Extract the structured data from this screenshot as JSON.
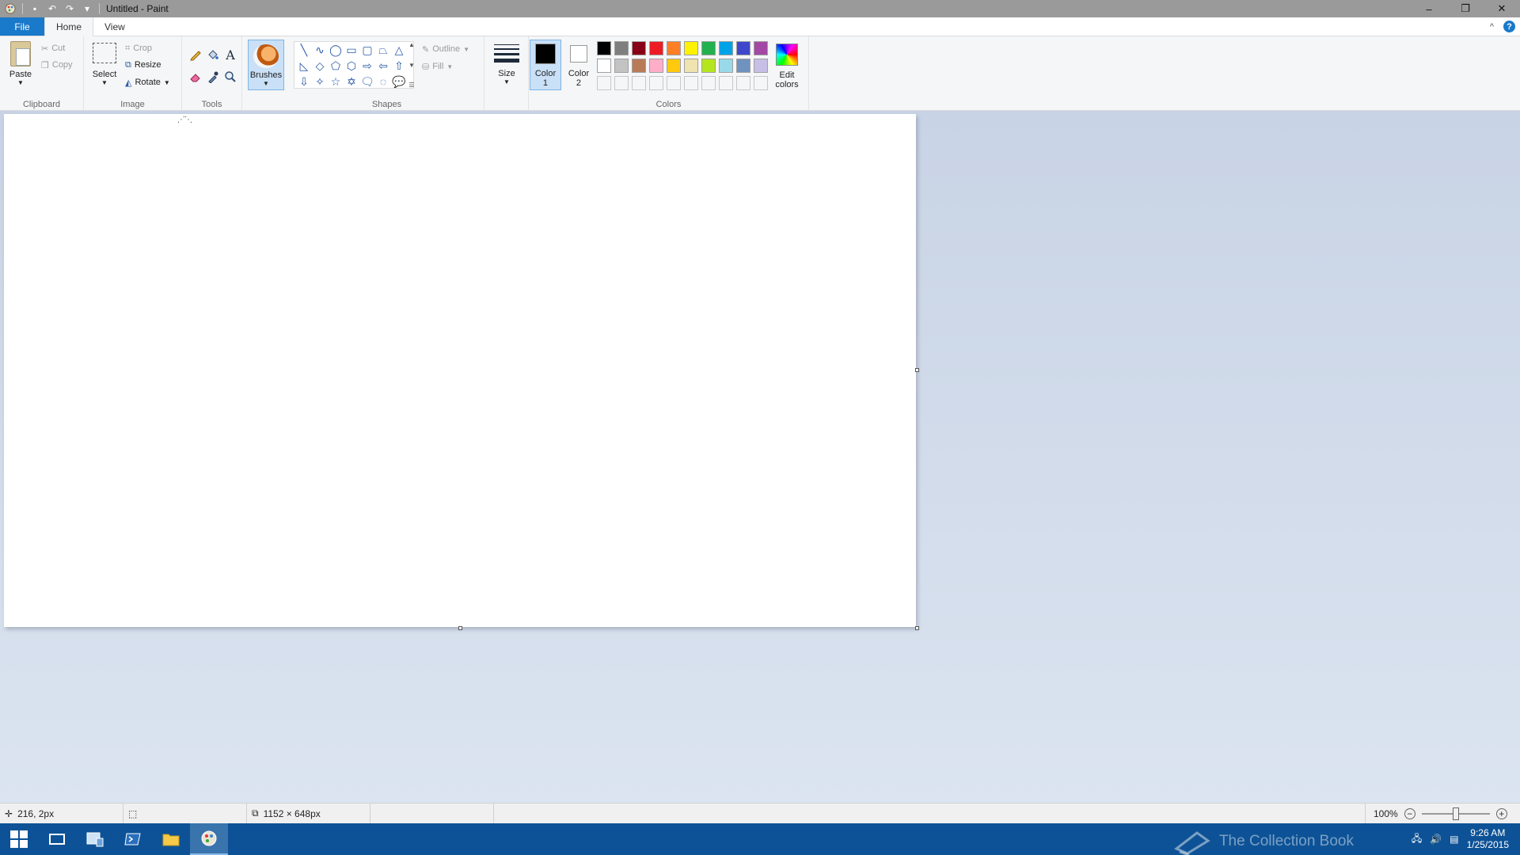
{
  "window": {
    "title": "Untitled - Paint",
    "minimize_glyph": "–",
    "restore_glyph": "❐",
    "close_glyph": "✕"
  },
  "quick_access": {
    "icons": [
      "paint-app-icon",
      "save-icon",
      "undo-icon",
      "redo-icon",
      "customize-qat-icon"
    ],
    "save_glyph": "▪",
    "undo_glyph": "↶",
    "redo_glyph": "↷",
    "customize_glyph": "▾"
  },
  "tabs": {
    "file": "File",
    "home": "Home",
    "view": "View",
    "help_glyph": "?",
    "collapse_glyph": "^"
  },
  "clipboard": {
    "paste": "Paste",
    "cut": "Cut",
    "copy": "Copy",
    "group": "Clipboard"
  },
  "image": {
    "select": "Select",
    "crop": "Crop",
    "resize": "Resize",
    "rotate": "Rotate",
    "group": "Image"
  },
  "tools": {
    "text_glyph": "A",
    "group": "Tools"
  },
  "brushes": {
    "label": "Brushes"
  },
  "shapes": {
    "items": [
      "╲",
      "∿",
      "◯",
      "▭",
      "▢",
      "⏢",
      "△",
      "◺",
      "◇",
      "⬠",
      "⬡",
      "⇨",
      "⇦",
      "⇧",
      "⇩",
      "✧",
      "☆",
      "✡",
      "🗨",
      "◌",
      "💬"
    ],
    "outline": "Outline",
    "fill": "Fill",
    "group": "Shapes"
  },
  "size": {
    "label": "Size"
  },
  "colors": {
    "color1": "Color\n1",
    "color1_value": "#000000",
    "color2": "Color\n2",
    "color2_value": "#ffffff",
    "edit_colors": "Edit\ncolors",
    "group": "Colors",
    "palette_row1": [
      "#000000",
      "#7f7f7f",
      "#880015",
      "#ed1c24",
      "#ff7f27",
      "#fff200",
      "#22b14c",
      "#00a2e8",
      "#3f48cc",
      "#a349a4"
    ],
    "palette_row2": [
      "#ffffff",
      "#c3c3c3",
      "#b97a57",
      "#ffaec9",
      "#ffc90e",
      "#efe4b0",
      "#b5e61d",
      "#99d9ea",
      "#7092be",
      "#c8bfe7"
    ]
  },
  "status": {
    "cursor_position": "216, 2px",
    "selection_size": "",
    "canvas_size": "1152 × 648px",
    "zoom": "100%",
    "zoom_level_fraction": 0.5
  },
  "taskbar": {
    "time": "9:26 AM",
    "date": "1/25/2015",
    "watermark": "The Collection Book"
  },
  "theme": {
    "accent": "#1979ca",
    "taskbar": "#0d5296",
    "ribbon": "#f5f6f7"
  }
}
